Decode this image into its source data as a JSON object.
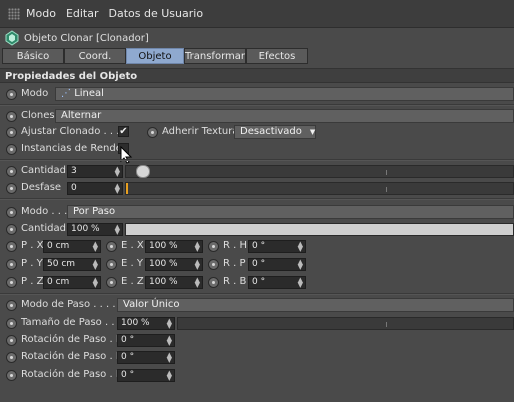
{
  "menu": [
    "Modo",
    "Editar",
    "Datos de Usuario"
  ],
  "object": {
    "title": "Objeto Clonar [Clonador]"
  },
  "tabs": [
    "Básico",
    "Coord.",
    "Objeto",
    "Transformar",
    "Efectos"
  ],
  "active_tab": "Objeto",
  "section": {
    "title": "Propiedades del Objeto"
  },
  "modo": {
    "label": "Modo",
    "value": "Lineal"
  },
  "clones": {
    "label": "Clones",
    "value": "Alternar"
  },
  "ajustar": {
    "label": "Ajustar Clonado . . . .",
    "checked": true,
    "checkmark": "✔"
  },
  "adherir": {
    "label": "Adherir Textura",
    "value": "Desactivado"
  },
  "instancias": {
    "label": "Instancias de Render",
    "checked": false
  },
  "cantidad": {
    "label": "Cantidad",
    "value": "3"
  },
  "desfase": {
    "label": "Desfase",
    "value": "0"
  },
  "modo2": {
    "label": "Modo . . .",
    "value": "Por Paso"
  },
  "cantidad2": {
    "label": "Cantidad",
    "value": "100 %",
    "fill_percent": 100
  },
  "pos": [
    {
      "label": "P . X",
      "value": "0 cm"
    },
    {
      "label": "P . Y",
      "value": "50 cm"
    },
    {
      "label": "P . Z",
      "value": "0 cm"
    }
  ],
  "scale": [
    {
      "label": "E . X",
      "value": "100 %"
    },
    {
      "label": "E . Y",
      "value": "100 %"
    },
    {
      "label": "E . Z",
      "value": "100 %"
    }
  ],
  "rot": [
    {
      "label": "R . H",
      "value": "0 °"
    },
    {
      "label": "R . P",
      "value": "0 °"
    },
    {
      "label": "R . B",
      "value": "0 °"
    }
  ],
  "modo_paso": {
    "label": "Modo de Paso . . . . .",
    "value": "Valor Único"
  },
  "tamano_paso": {
    "label": "Tamaño de Paso . . .",
    "value": "100 %"
  },
  "rot_paso": [
    {
      "label": "Rotación de Paso . H",
      "value": "0 °"
    },
    {
      "label": "Rotación de Paso . P",
      "value": "0 °"
    },
    {
      "label": "Rotación de Paso . B",
      "value": "0 °"
    }
  ],
  "colors": {
    "active_tab": "#8fa9cf",
    "background": "#4a4a4a",
    "field": "#2b2b2b"
  }
}
